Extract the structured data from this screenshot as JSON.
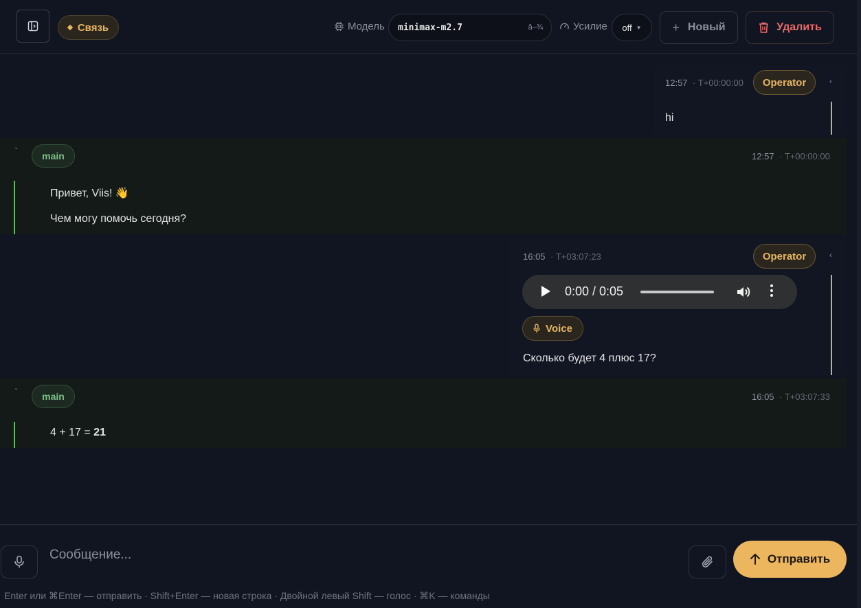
{
  "header": {
    "connection_label": "Связь",
    "model_label": "Модель",
    "model_value": "minimax-m2.7",
    "model_arrow": "â–¾",
    "effort_label": "Усилие",
    "effort_value": "off",
    "new_label": "Новый",
    "delete_label": "Удалить"
  },
  "messages": [
    {
      "role": "operator",
      "badge": "Operator",
      "time": "12:57",
      "offset": "· T+00:00:00",
      "text": "hi"
    },
    {
      "role": "agent",
      "badge": "main",
      "time": "12:57",
      "offset": "· T+00:00:00",
      "lines": [
        "Привет, Viis! 👋",
        "Чем могу помочь сегодня?"
      ]
    },
    {
      "role": "operator",
      "badge": "Operator",
      "time": "16:05",
      "offset": "· T+03:07:23",
      "audio_time": "0:00 / 0:05",
      "voice_label": "Voice",
      "text": "Сколько будет 4 плюс 17?"
    },
    {
      "role": "agent",
      "badge": "main",
      "time": "16:05",
      "offset": "· T+03:07:33",
      "expr": "4 + 17 = ",
      "result": "21"
    }
  ],
  "composer": {
    "placeholder": "Сообщение...",
    "send_label": "Отправить",
    "hints": "Enter или ⌘Enter — отправить · Shift+Enter — новая строка · Двойной левый Shift — голос · ⌘K — команды"
  },
  "colors": {
    "accent": "#ebb65e",
    "agent_green": "#79c086",
    "danger": "#e66a6a",
    "background": "#111521"
  }
}
